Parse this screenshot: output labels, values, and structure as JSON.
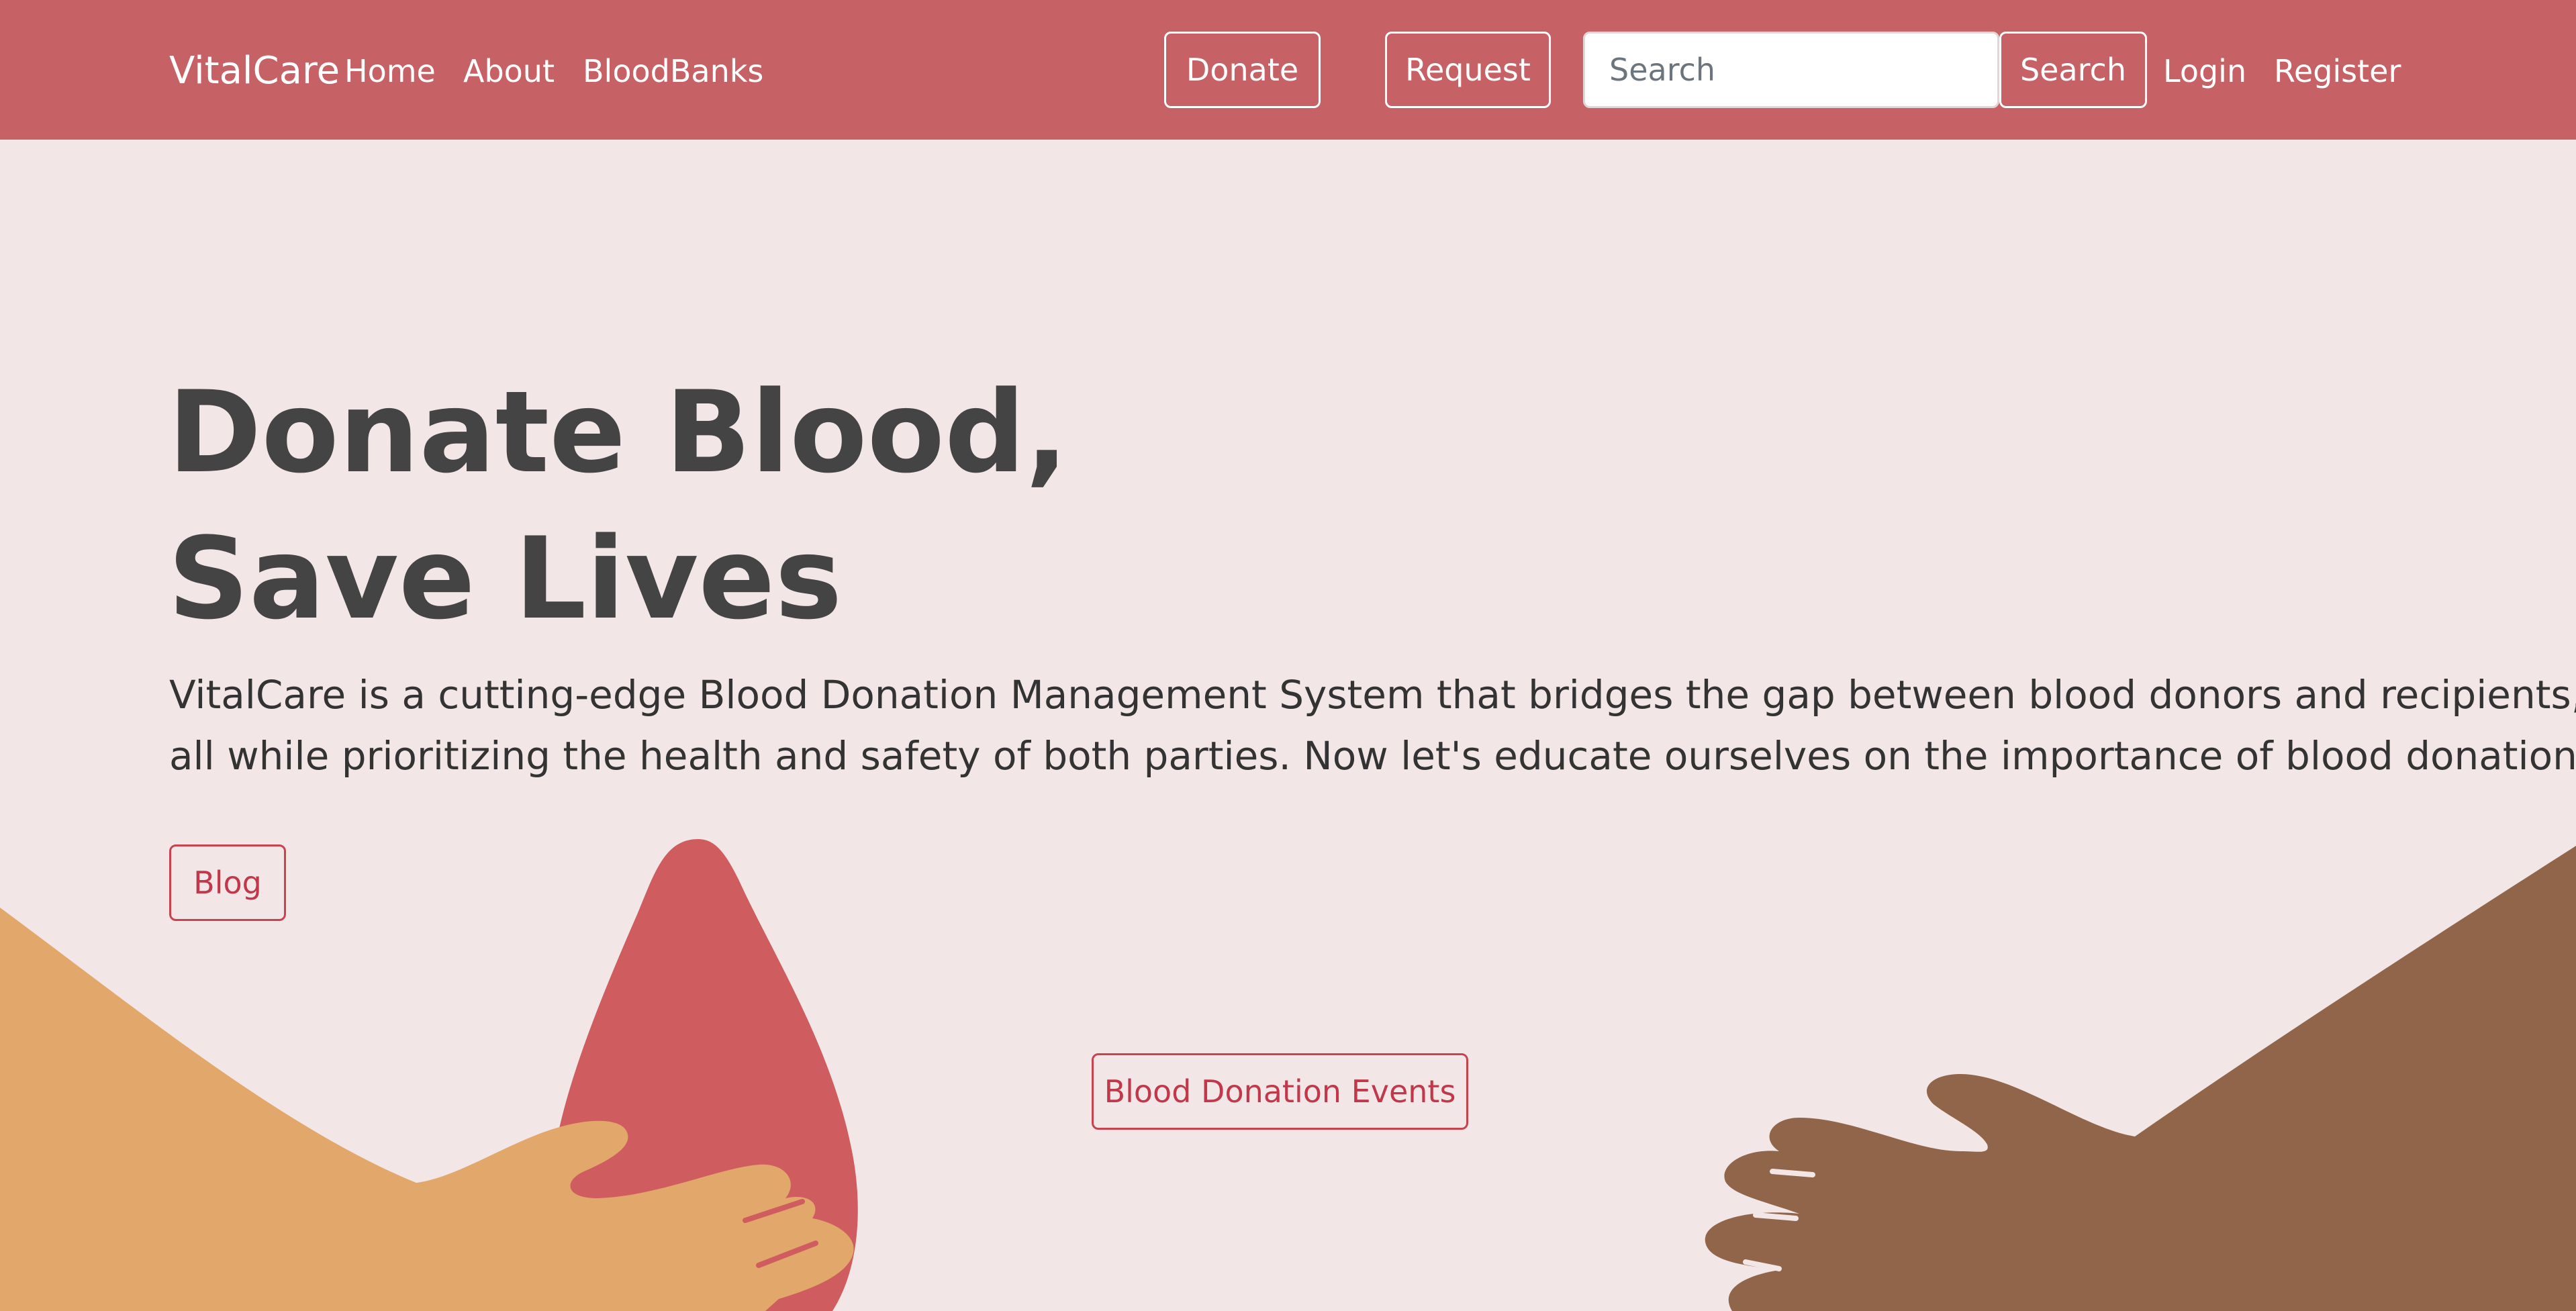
{
  "navbar": {
    "brand": "VitalCare",
    "links": [
      "Home",
      "About",
      "BloodBanks"
    ],
    "donate_label": "Donate",
    "request_label": "Request",
    "search_placeholder": "Search",
    "search_value": "",
    "search_button_label": "Search",
    "login_label": "Login",
    "register_label": "Register"
  },
  "hero": {
    "title_line1": "Donate Blood,",
    "title_line2": "Save Lives",
    "description_line1": "VitalCare is a cutting-edge Blood Donation Management System that bridges the gap between blood donors and recipients,",
    "description_line2": "all while prioritizing the health and safety of both parties. Now let's educate ourselves on the importance of blood donation.",
    "blog_label": "Blog",
    "events_label": "Blood Donation Events"
  },
  "illustration": {
    "icons": [
      "blood-drop-icon",
      "left-hand-icon",
      "right-hand-icon"
    ]
  },
  "colors": {
    "navbar_bg": "#c66166",
    "page_bg": "#f3e6e6",
    "accent_red": "#c9434f",
    "blood_drop": "#cf5c5f",
    "left_hand": "#e2a76a",
    "right_hand": "#91654a",
    "heading_text": "#444444"
  }
}
